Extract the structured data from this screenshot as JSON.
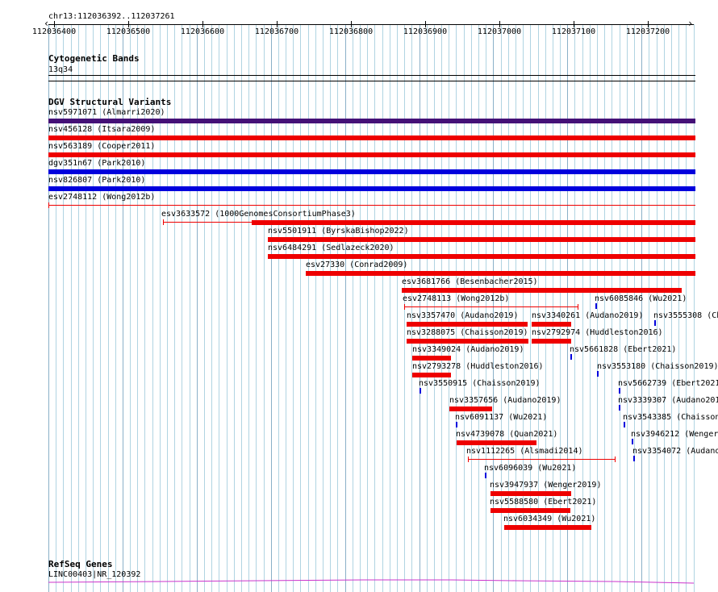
{
  "location": "chr13:112036392..112037261",
  "ruler": {
    "ticks": [
      "112036400",
      "112036500",
      "112036600",
      "112036700",
      "112036800",
      "112036900",
      "112037000",
      "112037100",
      "112037200"
    ]
  },
  "tracks": {
    "cytoband": {
      "title": "Cytogenetic Bands",
      "band": "13q34"
    },
    "dgv": {
      "title": "DGV Structural Variants"
    },
    "refseq": {
      "title": "RefSeq Genes",
      "gene": "LINC00403|NR_120392"
    }
  },
  "colors": {
    "gridline": "#b0d4e2",
    "gridline_major": "#8ab0c8",
    "loss": "#ee0000",
    "gain": "#0000dd",
    "gain_loss": "#441177",
    "gene": "#cc33cc"
  },
  "features": [
    {
      "label": "nsv5971071 (Almarri2020)",
      "type": "gain_loss"
    },
    {
      "label": "nsv456128 (Itsara2009)",
      "type": "loss"
    },
    {
      "label": "nsv563189 (Cooper2011)",
      "type": "loss"
    },
    {
      "label": "dgv351n67 (Park2010)",
      "type": "gain"
    },
    {
      "label": "nsv826807 (Park2010)",
      "type": "gain"
    },
    {
      "label": "esv2748112 (Wong2012b)",
      "type": "loss"
    },
    {
      "label": "esv3633572 (1000GenomesConsortiumPhase3)",
      "type": "loss"
    },
    {
      "label": "nsv5501911 (ByrskaBishop2022)",
      "type": "loss"
    },
    {
      "label": "nsv6484291 (Sedlazeck2020)",
      "type": "loss"
    },
    {
      "label": "esv27330 (Conrad2009)",
      "type": "loss"
    },
    {
      "label": "esv3681766 (Besenbacher2015)",
      "type": "loss"
    },
    {
      "label": "esv2748113 (Wong2012b)",
      "type": "loss"
    },
    {
      "label": "nsv6085846 (Wu2021)",
      "type": "gain"
    },
    {
      "label": "nsv3357470 (Audano2019)",
      "type": "loss"
    },
    {
      "label": "nsv3340261 (Audano2019)",
      "type": "loss"
    },
    {
      "label": "nsv3555308 (Ch",
      "type": "gain"
    },
    {
      "label": "nsv3288075 (Chaisson2019)",
      "type": "loss"
    },
    {
      "label": "nsv2792974 (Huddleston2016)",
      "type": "loss"
    },
    {
      "label": "nsv3349024 (Audano2019)",
      "type": "loss"
    },
    {
      "label": "nsv5661828 (Ebert2021)",
      "type": "gain"
    },
    {
      "label": "nsv2793278 (Huddleston2016)",
      "type": "loss"
    },
    {
      "label": "nsv3553180 (Chaisson2019)",
      "type": "gain"
    },
    {
      "label": "nsv3550915 (Chaisson2019)",
      "type": "gain"
    },
    {
      "label": "nsv5662739 (Ebert2021",
      "type": "gain"
    },
    {
      "label": "nsv3357656 (Audano2019)",
      "type": "loss"
    },
    {
      "label": "nsv3339307 (Audano201",
      "type": "gain"
    },
    {
      "label": "nsv6091137 (Wu2021)",
      "type": "gain"
    },
    {
      "label": "nsv3543385 (Chaisson",
      "type": "gain"
    },
    {
      "label": "nsv4739078 (Quan2021)",
      "type": "loss"
    },
    {
      "label": "nsv3946212 (Wenger",
      "type": "gain"
    },
    {
      "label": "nsv1112265 (Alsmadi2014)",
      "type": "loss"
    },
    {
      "label": "nsv3354072 (Audano",
      "type": "gain"
    },
    {
      "label": "nsv6096039 (Wu2021)",
      "type": "gain"
    },
    {
      "label": "nsv3947937 (Wenger2019)",
      "type": "loss"
    },
    {
      "label": "nsv5588580 (Ebert2021)",
      "type": "loss"
    },
    {
      "label": "nsv6034349 (Wu2021)",
      "type": "loss"
    }
  ]
}
